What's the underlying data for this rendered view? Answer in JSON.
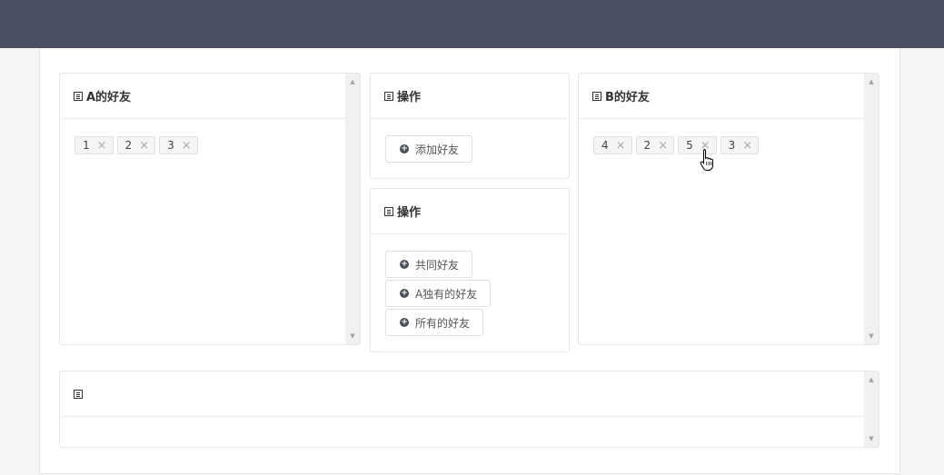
{
  "panelA": {
    "title": "A的好友",
    "tags": [
      "1",
      "2",
      "3"
    ]
  },
  "opsTop": {
    "title": "操作",
    "buttons": [
      "添加好友"
    ]
  },
  "opsBottom": {
    "title": "操作",
    "buttons": [
      "共同好友",
      "A独有的好友",
      "所有的好友"
    ]
  },
  "panelB": {
    "title": "B的好友",
    "tags": [
      "4",
      "2",
      "5",
      "3"
    ]
  },
  "result": {
    "title": ""
  },
  "icons": {
    "list": "list-icon",
    "add": "plus-circle-icon",
    "remove": "close-icon",
    "scroll_up": "scroll-up-arrow",
    "scroll_down": "scroll-down-arrow",
    "cursor": "hand-pointer-cursor"
  },
  "colors": {
    "topbar": "#4a5061",
    "page_bg": "#f4f5f7",
    "tag_bg": "#f5f5f5"
  }
}
